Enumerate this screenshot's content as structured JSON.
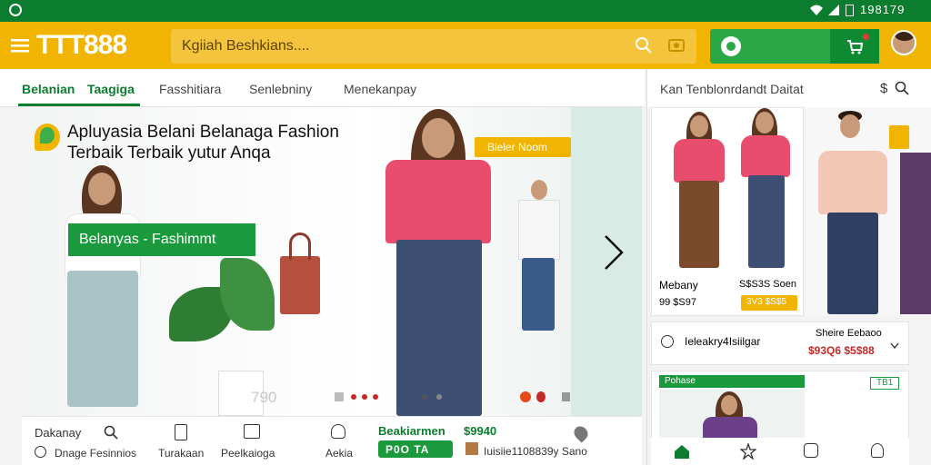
{
  "status": {
    "time": "198179"
  },
  "appbar": {
    "brand": "TTT888",
    "search_placeholder": "Kgiiah Beshkians...."
  },
  "tabs": [
    {
      "label": "Belanian",
      "active": true
    },
    {
      "label": "Taagiga",
      "active": true
    },
    {
      "label": "Fasshitiara",
      "active": false
    },
    {
      "label": "Senlebniny",
      "active": false
    },
    {
      "label": "Menekanpay",
      "active": false
    }
  ],
  "right_header": {
    "title": "Kan  Tenblonrdandt Daitat"
  },
  "hero": {
    "headline": "Apluyasia Belani Belanaga Fashion Terbaik Terbaik yutur Anqa",
    "cta_label": "Belanyas - Fashimmt",
    "badge": "Bieler Noom",
    "footer_num": "790"
  },
  "bottom_nav": {
    "search_label": "Dakanay",
    "items": [
      {
        "label": "Dnage Fesinnios"
      },
      {
        "label": "Turakaan"
      },
      {
        "label": "Peelkaioga"
      },
      {
        "label": "Aekia"
      }
    ],
    "promo_title": "Beakiarmen",
    "promo_price": "$9940",
    "promo_btn": "P0O TA",
    "promo_sub": "Iuisiie1108839y Sano"
  },
  "right_panel": {
    "product": {
      "name": "Mebany",
      "price": "S$S3S Soen",
      "old": "99 $S97",
      "badge": "3V3 $S$5"
    },
    "search_row": {
      "text": "Ieleakry4Isiilgar",
      "title": "Sheire Eebaoo",
      "price": "$93Q6 $5$88"
    },
    "promo_card": {
      "label": "Pohase",
      "badge": "TB1"
    }
  },
  "colors": {
    "green": "#0c7d2f",
    "yellow": "#f1b400",
    "pink": "#e84d6e"
  }
}
